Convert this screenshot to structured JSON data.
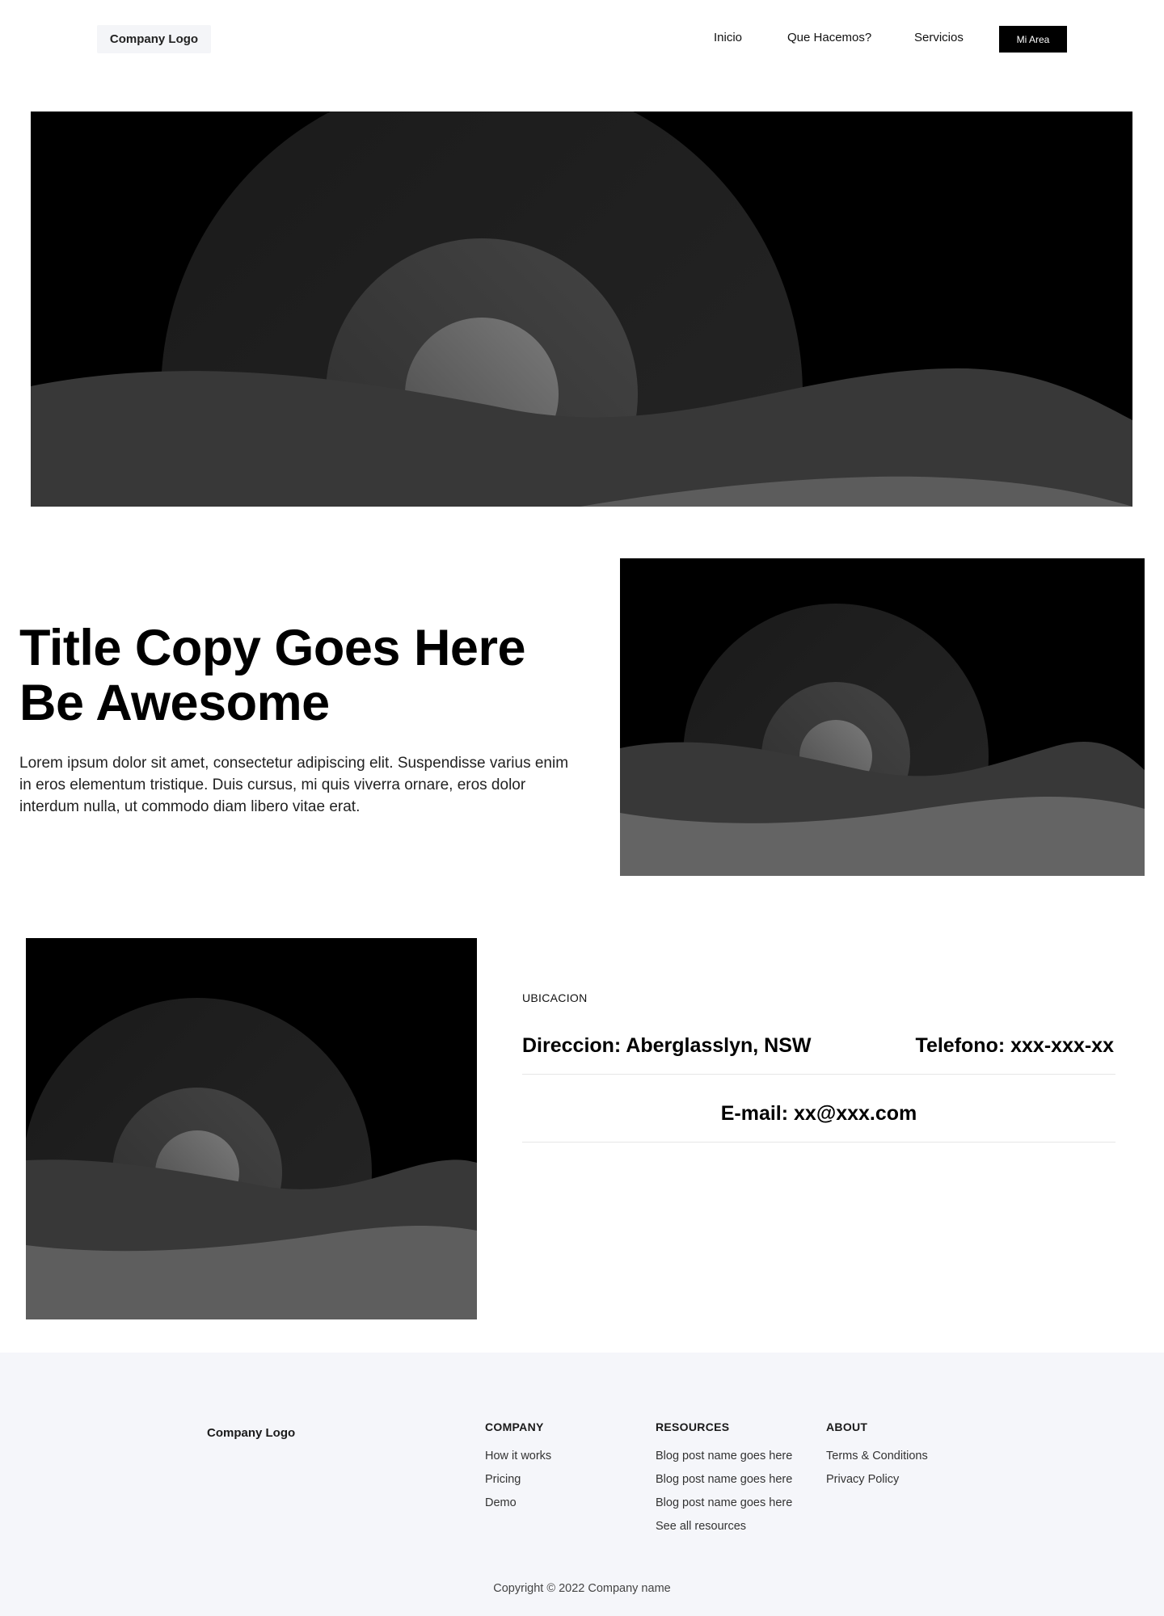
{
  "nav": {
    "logo": "Company Logo",
    "links": [
      "Inicio",
      "Que Hacemos?",
      "Servicios"
    ],
    "cta": "Mi Area"
  },
  "hero": {
    "title": "Title Copy Goes Here Be Awesome",
    "body": "Lorem ipsum dolor sit amet, consectetur adipiscing elit. Suspendisse varius enim in eros elementum tristique. Duis cursus, mi quis viverra ornare, eros dolor interdum nulla, ut commodo diam libero vitae erat."
  },
  "location": {
    "eyebrow": "UBICACION",
    "address": "Direccion: Aberglasslyn, NSW",
    "phone": "Telefono: xxx-xxx-xx",
    "email": "E-mail: xx@xxx.com"
  },
  "footer": {
    "logo": "Company Logo",
    "columns": [
      {
        "heading": "COMPANY",
        "links": [
          "How it works",
          "Pricing",
          "Demo"
        ]
      },
      {
        "heading": "RESOURCES",
        "links": [
          "Blog post name goes here",
          "Blog post name goes here",
          "Blog post name goes here",
          "See all resources"
        ]
      },
      {
        "heading": "ABOUT",
        "links": [
          "Terms & Conditions",
          "Privacy Policy"
        ]
      }
    ],
    "copyright": "Copyright © 2022 Company name"
  },
  "colors": {
    "cta_bg": "#000000",
    "footer_bg": "#f5f6fa",
    "logo_bg": "#f4f5f8"
  },
  "images": [
    {
      "name": "banner-image",
      "icon": "image-placeholder-icon"
    },
    {
      "name": "hero-image",
      "icon": "image-placeholder-icon"
    },
    {
      "name": "location-image",
      "icon": "image-placeholder-icon"
    }
  ]
}
